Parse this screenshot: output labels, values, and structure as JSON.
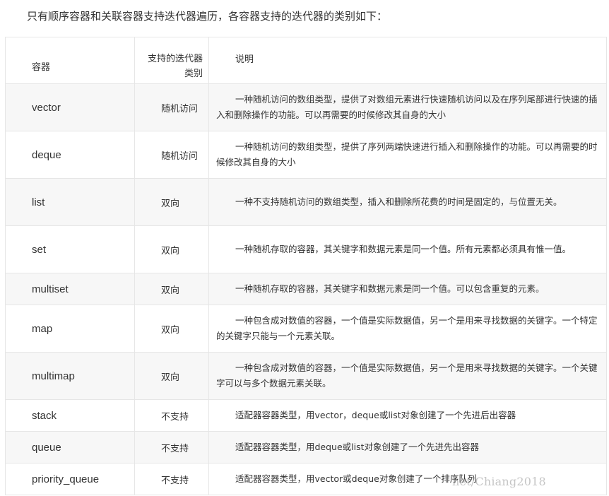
{
  "intro_text": "只有顺序容器和关联容器支持迭代器遍历，各容器支持的迭代器的类别如下：",
  "table": {
    "headers": {
      "container": "容器",
      "iterator": "支持的迭代器类别",
      "description": "说明"
    },
    "rows": [
      {
        "name": "vector",
        "iterator": "随机访问",
        "description": "一种随机访问的数组类型，提供了对数组元素进行快速随机访问以及在序列尾部进行快速的插入和删除操作的功能。可以再需要的时候修改其自身的大小"
      },
      {
        "name": "deque",
        "iterator": "随机访问",
        "description": "一种随机访问的数组类型，提供了序列两端快速进行插入和删除操作的功能。可以再需要的时候修改其自身的大小"
      },
      {
        "name": "list",
        "iterator": "双向",
        "description": "一种不支持随机访问的数组类型，插入和删除所花费的时间是固定的，与位置无关。"
      },
      {
        "name": "set",
        "iterator": "双向",
        "description": "一种随机存取的容器，其关键字和数据元素是同一个值。所有元素都必须具有惟一值。"
      },
      {
        "name": "multiset",
        "iterator": "双向",
        "description": "一种随机存取的容器，其关键字和数据元素是同一个值。可以包含重复的元素。"
      },
      {
        "name": "map",
        "iterator": "双向",
        "description": "一种包含成对数值的容器，一个值是实际数据值，另一个是用来寻找数据的关键字。一个特定的关键字只能与一个元素关联。"
      },
      {
        "name": "multimap",
        "iterator": "双向",
        "description": "一种包含成对数值的容器，一个值是实际数据值，另一个是用来寻找数据的关键字。一个关键字可以与多个数据元素关联。"
      },
      {
        "name": "stack",
        "iterator": "不支持",
        "description": "适配器容器类型，用vector，deque或list对象创建了一个先进后出容器"
      },
      {
        "name": "queue",
        "iterator": "不支持",
        "description": "适配器容器类型，用deque或list对象创建了一个先进先出容器"
      },
      {
        "name": "priority_queue",
        "iterator": "不支持",
        "description": "适配器容器类型，用vector或deque对象创建了一个排序队列"
      }
    ]
  },
  "watermark": "net/Chiang2018"
}
